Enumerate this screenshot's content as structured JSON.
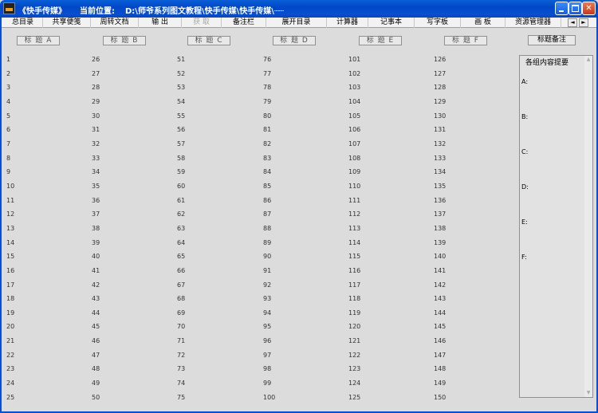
{
  "window": {
    "title": "《快手传媒》",
    "location_label": "当前位置:",
    "location_path": "D:\\师爷系列图文教程\\快手传媒\\快手传媒\\┈┈",
    "minimize_glyph": "",
    "maximize_glyph": "",
    "close_glyph": "✕"
  },
  "toolbar": {
    "items": [
      {
        "label": "总目录",
        "enabled": true
      },
      {
        "label": "共享便笺",
        "enabled": true
      },
      {
        "label": "周转文档",
        "enabled": true
      },
      {
        "label": "输 出",
        "enabled": true
      },
      {
        "label": "获 取",
        "enabled": false
      },
      {
        "label": "备注栏",
        "enabled": true
      },
      {
        "label": "展开目录",
        "enabled": true
      },
      {
        "label": "计算器",
        "enabled": true
      },
      {
        "label": "记事本",
        "enabled": true
      },
      {
        "label": "写字板",
        "enabled": true
      },
      {
        "label": "画 板",
        "enabled": true
      },
      {
        "label": "资源管理器",
        "enabled": true
      }
    ],
    "scroll_left": "◄",
    "scroll_right": "►"
  },
  "columns": [
    {
      "header": "标 题 A",
      "values": [
        "1",
        "2",
        "3",
        "4",
        "5",
        "6",
        "7",
        "8",
        "9",
        "10",
        "11",
        "12",
        "13",
        "14",
        "15",
        "16",
        "17",
        "18",
        "19",
        "20",
        "21",
        "22",
        "23",
        "24",
        "25"
      ]
    },
    {
      "header": "标 题 B",
      "values": [
        "26",
        "27",
        "28",
        "29",
        "30",
        "31",
        "32",
        "33",
        "34",
        "35",
        "36",
        "37",
        "38",
        "39",
        "40",
        "41",
        "42",
        "43",
        "44",
        "45",
        "46",
        "47",
        "48",
        "49",
        "50"
      ]
    },
    {
      "header": "标 题 C",
      "values": [
        "51",
        "52",
        "53",
        "54",
        "55",
        "56",
        "57",
        "58",
        "59",
        "60",
        "61",
        "62",
        "63",
        "64",
        "65",
        "66",
        "67",
        "68",
        "69",
        "70",
        "71",
        "72",
        "73",
        "74",
        "75"
      ]
    },
    {
      "header": "标 题 D",
      "values": [
        "76",
        "77",
        "78",
        "79",
        "80",
        "81",
        "82",
        "83",
        "84",
        "85",
        "86",
        "87",
        "88",
        "89",
        "90",
        "91",
        "92",
        "93",
        "94",
        "95",
        "96",
        "97",
        "98",
        "99",
        "100"
      ]
    },
    {
      "header": "标 题 E",
      "values": [
        "101",
        "102",
        "103",
        "104",
        "105",
        "106",
        "107",
        "108",
        "109",
        "110",
        "111",
        "112",
        "113",
        "114",
        "115",
        "116",
        "117",
        "118",
        "119",
        "120",
        "121",
        "122",
        "123",
        "124",
        "125"
      ]
    },
    {
      "header": "标 题 F",
      "values": [
        "126",
        "127",
        "128",
        "129",
        "130",
        "131",
        "132",
        "133",
        "134",
        "135",
        "136",
        "137",
        "138",
        "139",
        "140",
        "141",
        "142",
        "143",
        "144",
        "145",
        "146",
        "147",
        "148",
        "149",
        "150"
      ]
    }
  ],
  "notes": {
    "header": "标题备注",
    "title": "各组内容提要",
    "labels": [
      "A:",
      "B:",
      "C:",
      "D:",
      "E:",
      "F:"
    ],
    "scroll_up": "▲",
    "scroll_down": "▼"
  }
}
